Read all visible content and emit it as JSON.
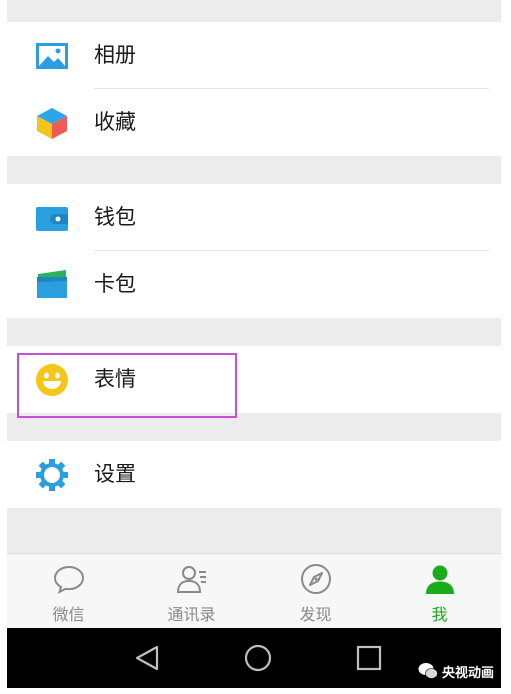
{
  "menu": {
    "album": "相册",
    "favorites": "收藏",
    "wallet": "钱包",
    "cards": "卡包",
    "stickers": "表情",
    "settings": "设置"
  },
  "tabs": [
    {
      "label": "微信",
      "icon": "chat-bubble-icon",
      "active": false
    },
    {
      "label": "通讯录",
      "icon": "contacts-icon",
      "active": false
    },
    {
      "label": "发现",
      "icon": "compass-icon",
      "active": false
    },
    {
      "label": "我",
      "icon": "person-icon",
      "active": true
    }
  ],
  "watermark": "央视动画",
  "colors": {
    "active_tab": "#1aad19",
    "highlight_border": "#c64fd8",
    "icon_blue": "#2a9fe0"
  }
}
